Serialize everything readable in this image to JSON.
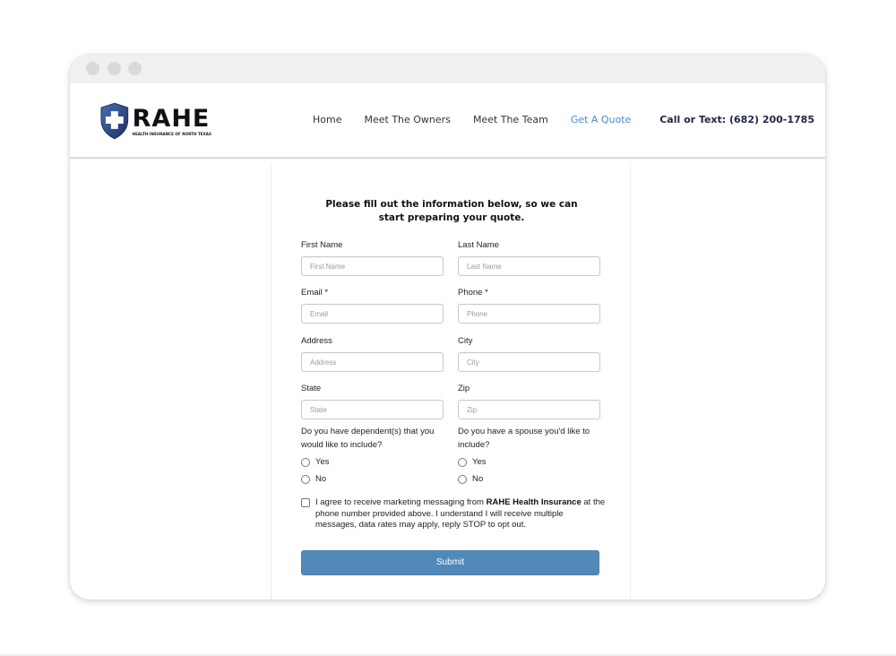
{
  "window": {
    "controls": [
      "close",
      "minimize",
      "maximize"
    ]
  },
  "header": {
    "logo": {
      "icon": "shield-cross-icon",
      "wordmark": "RAHE",
      "tagline": "HEALTH INSURANCE OF NORTH TEXAS",
      "shield_color": "#2a4a8c"
    },
    "nav": [
      {
        "label": "Home",
        "active": false
      },
      {
        "label": "Meet The Owners",
        "active": false
      },
      {
        "label": "Meet The Team",
        "active": false
      },
      {
        "label": "Get A Quote",
        "active": true
      }
    ],
    "contact": "Call or Text: (682) 200-1785",
    "accent_color": "#4a8cc9"
  },
  "form": {
    "intro": "Please fill out the information below, so we can start preparing your quote.",
    "fields": {
      "first_name": {
        "label": "First Name",
        "placeholder": "First Name",
        "value": ""
      },
      "last_name": {
        "label": "Last Name",
        "placeholder": "Last Name",
        "value": ""
      },
      "email": {
        "label": "Email *",
        "placeholder": "Email",
        "value": ""
      },
      "phone": {
        "label": "Phone *",
        "placeholder": "Phone",
        "value": ""
      },
      "address": {
        "label": "Address",
        "placeholder": "Address",
        "value": ""
      },
      "city": {
        "label": "City",
        "placeholder": "City",
        "value": ""
      },
      "state": {
        "label": "State",
        "placeholder": "State",
        "value": ""
      },
      "zip": {
        "label": "Zip",
        "placeholder": "Zip",
        "value": ""
      }
    },
    "dependents": {
      "question": "Do you have dependent(s) that you would like to include?",
      "options": [
        "Yes",
        "No"
      ],
      "selected": null
    },
    "spouse": {
      "question": "Do you have a spouse you'd like to include?",
      "options": [
        "Yes",
        "No"
      ],
      "selected": null
    },
    "consent": {
      "text_before": "I agree to receive marketing messaging from ",
      "brand": "RAHE Health Insurance",
      "text_after": " at the phone number provided above. I understand I will receive multiple messages, data rates may apply, reply STOP to opt out.",
      "checked": false
    },
    "submit_label": "Submit",
    "submit_color": "#5189b9"
  }
}
